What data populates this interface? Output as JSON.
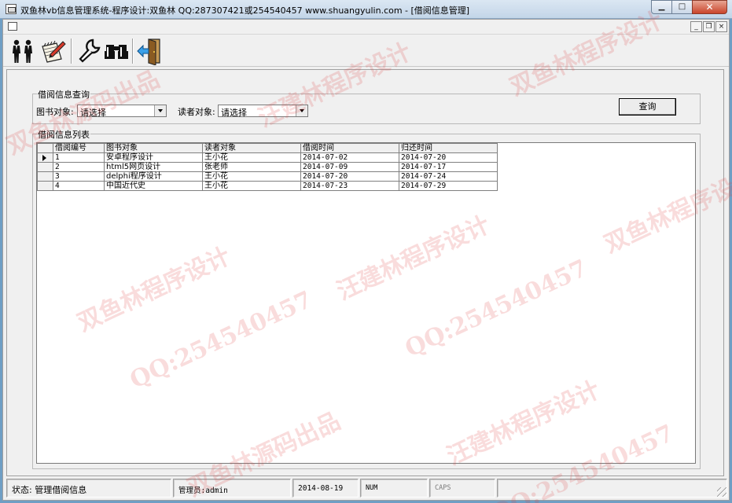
{
  "window": {
    "title": "双鱼林vb信息管理系统-程序设计:双鱼林 QQ:287307421或254540457 www.shuangyulin.com - [借阅信息管理]",
    "minimize_glyph": "▁",
    "maximize_glyph": "□",
    "close_glyph": "✕"
  },
  "child_window": {
    "minimize_glyph": "_",
    "restore_glyph": "❐",
    "close_glyph": "×"
  },
  "toolbar": {
    "buttons": [
      {
        "name": "reader-management-button",
        "icon": "people-icon"
      },
      {
        "name": "borrow-management-button",
        "icon": "notepad-pen-icon"
      },
      {
        "name": "settings-button",
        "icon": "wrench-icon"
      },
      {
        "name": "search-button",
        "icon": "binoculars-icon"
      },
      {
        "name": "exit-button",
        "icon": "door-exit-icon"
      }
    ]
  },
  "query": {
    "group_label": "借阅信息查询",
    "book_label": "图书对象:",
    "book_value": "请选择",
    "reader_label": "读者对象:",
    "reader_value": "请选择",
    "query_button": "查询"
  },
  "list": {
    "group_label": "借阅信息列表",
    "columns": [
      "借阅编号",
      "图书对象",
      "读者对象",
      "借阅时间",
      "归还时间"
    ],
    "rows": [
      [
        "1",
        "安卓程序设计",
        "王小花",
        "2014-07-02",
        "2014-07-20"
      ],
      [
        "2",
        "html5网页设计",
        "张老师",
        "2014-07-09",
        "2014-07-17"
      ],
      [
        "3",
        "delphi程序设计",
        "王小花",
        "2014-07-20",
        "2014-07-24"
      ],
      [
        "4",
        "中国近代史",
        "王小花",
        "2014-07-23",
        "2014-07-29"
      ]
    ],
    "current_row": 0
  },
  "status": {
    "state": "状态: 管理借阅信息",
    "admin": "管理员:admin",
    "date": "2014-08-19",
    "num": "NUM",
    "caps": "CAPS"
  },
  "watermark": {
    "texts": [
      "双鱼林源码出品",
      "汪建林程序设计",
      "QQ:254540457",
      "双鱼林程序设计"
    ],
    "color": "#dc3c3c"
  }
}
